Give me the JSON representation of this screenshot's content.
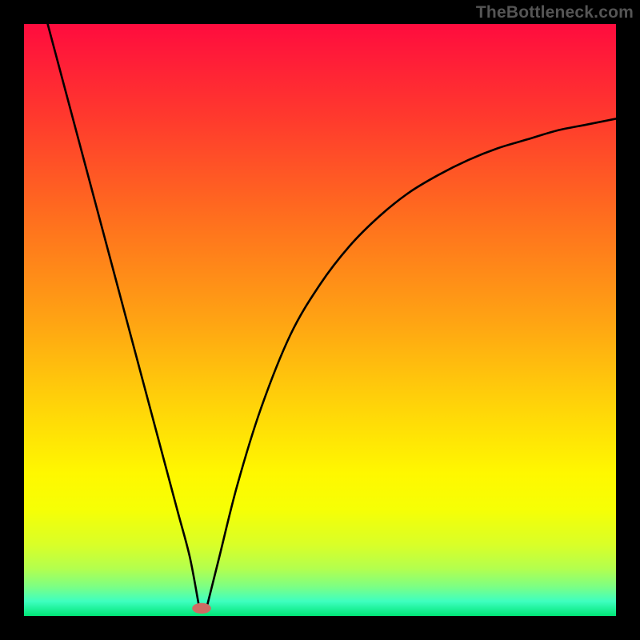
{
  "attribution": "TheBottleneck.com",
  "chart_data": {
    "type": "line",
    "title": "",
    "xlabel": "",
    "ylabel": "",
    "xlim": [
      0,
      100
    ],
    "ylim": [
      0,
      100
    ],
    "gradient_stops": [
      {
        "offset": 0.0,
        "color": "#ff0c3e"
      },
      {
        "offset": 0.16,
        "color": "#ff3a2d"
      },
      {
        "offset": 0.33,
        "color": "#ff6f1e"
      },
      {
        "offset": 0.5,
        "color": "#ffa313"
      },
      {
        "offset": 0.63,
        "color": "#ffcf0a"
      },
      {
        "offset": 0.76,
        "color": "#fff800"
      },
      {
        "offset": 0.82,
        "color": "#f6ff05"
      },
      {
        "offset": 0.88,
        "color": "#d9ff28"
      },
      {
        "offset": 0.92,
        "color": "#b3ff4e"
      },
      {
        "offset": 0.95,
        "color": "#7dff83"
      },
      {
        "offset": 0.975,
        "color": "#3fffc0"
      },
      {
        "offset": 1.0,
        "color": "#00e676"
      }
    ],
    "series": [
      {
        "name": "left-branch",
        "x": [
          4,
          6,
          8,
          10,
          12,
          14,
          16,
          18,
          20,
          22,
          24,
          26,
          28,
          29.5
        ],
        "values": [
          100,
          92.5,
          85,
          77.5,
          70,
          62.5,
          55,
          47.5,
          40,
          32.5,
          25,
          17.5,
          10,
          2
        ]
      },
      {
        "name": "right-branch",
        "x": [
          31,
          33,
          36,
          40,
          45,
          50,
          55,
          60,
          65,
          70,
          75,
          80,
          85,
          90,
          95,
          100
        ],
        "values": [
          2,
          10,
          22,
          35,
          47.5,
          56,
          62.5,
          67.5,
          71.5,
          74.5,
          77,
          79,
          80.5,
          82,
          83,
          84
        ]
      }
    ],
    "marker": {
      "x": 30,
      "y": 1.3,
      "rx": 1.6,
      "ry": 0.9,
      "fill": "#cf6b63"
    },
    "curve_stroke": "#000000",
    "curve_width": 2.6
  }
}
